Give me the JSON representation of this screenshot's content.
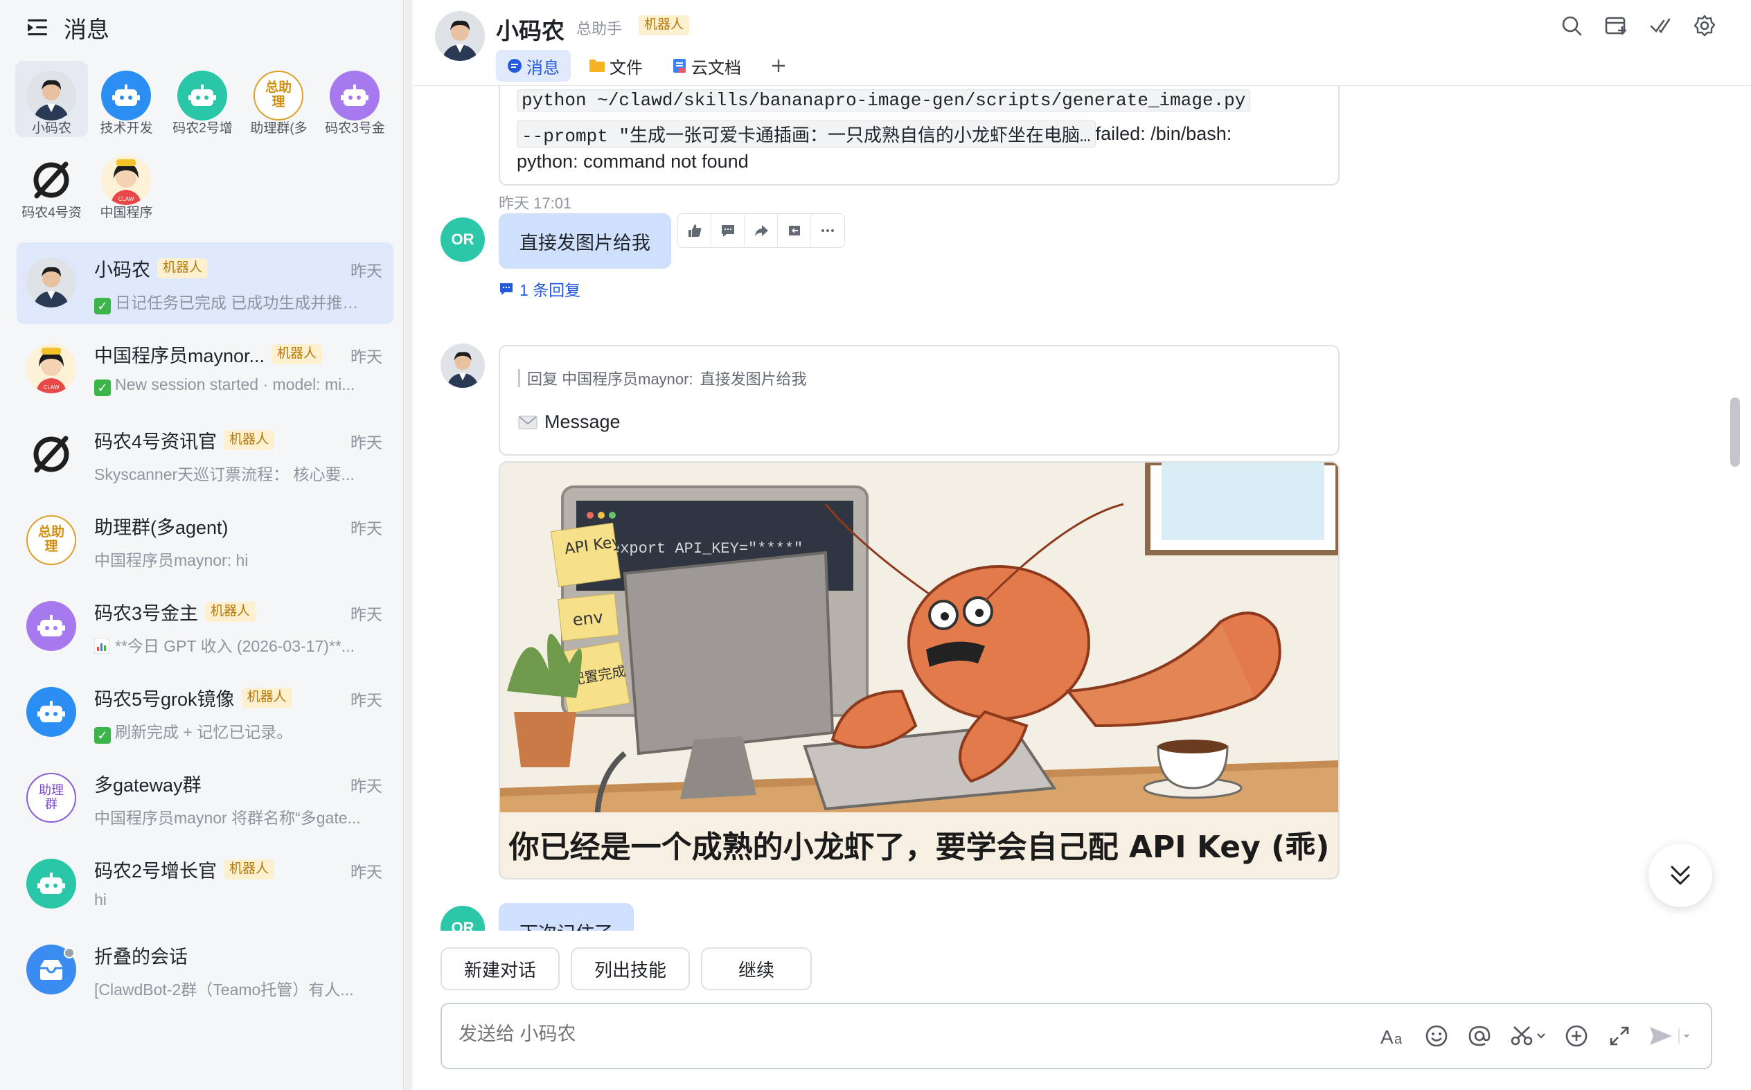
{
  "sidebar": {
    "title": "消息",
    "quick": [
      {
        "label": "小码农",
        "avatar": "person",
        "active": true
      },
      {
        "label": "技术开发",
        "avatar": "robot-blue"
      },
      {
        "label": "码农2号增",
        "avatar": "robot-teal"
      },
      {
        "label": "助理群(多",
        "avatar": "help",
        "text": "总助理"
      },
      {
        "label": "码农3号金",
        "avatar": "robot-purple"
      },
      {
        "label": "码农4号资",
        "avatar": "null-sign"
      },
      {
        "label": "中国程序",
        "avatar": "girl"
      }
    ],
    "conversations": [
      {
        "name": "小码农",
        "badge": "机器人",
        "time": "昨天",
        "preview": "日记任务已完成 已成功生成并推…",
        "preview_icon": "check",
        "avatar": "person",
        "active": true
      },
      {
        "name": "中国程序员maynor...",
        "badge": "机器人",
        "time": "昨天",
        "preview": "New session started · model: mi...",
        "preview_icon": "check",
        "avatar": "girl"
      },
      {
        "name": "码农4号资讯官",
        "badge": "机器人",
        "time": "昨天",
        "preview": "Skyscanner天巡订票流程： 核心要...",
        "avatar": "null-sign"
      },
      {
        "name": "助理群(多agent)",
        "badge": "",
        "time": "昨天",
        "preview": "中国程序员maynor: hi",
        "avatar": "help",
        "avatar_text": "总助理"
      },
      {
        "name": "码农3号金主",
        "badge": "机器人",
        "time": "昨天",
        "preview": "**今日 GPT 收入 (2026-03-17)**...",
        "preview_icon": "chart",
        "avatar": "robot-purple"
      },
      {
        "name": "码农5号grok镜像",
        "badge": "机器人",
        "time": "昨天",
        "preview": "刷新完成 + 记忆已记录。",
        "preview_icon": "check",
        "avatar": "robot-blue"
      },
      {
        "name": "多gateway群",
        "badge": "",
        "time": "昨天",
        "preview": "中国程序员maynor 将群名称“多gate...",
        "avatar": "group",
        "avatar_text": "助理群"
      },
      {
        "name": "码农2号增长官",
        "badge": "机器人",
        "time": "昨天",
        "preview": "hi",
        "avatar": "robot-teal"
      },
      {
        "name": "折叠的会话",
        "badge": "",
        "time": "",
        "preview": "[ClawdBot-2群（Teamo托管）有人...",
        "avatar": "fold"
      }
    ]
  },
  "chat": {
    "title": "小码农",
    "subtitle": "总助手",
    "badge": "机器人",
    "tabs": [
      {
        "label": "消息",
        "icon": "chat-bubble-icon",
        "active": true
      },
      {
        "label": "文件",
        "icon": "folder-icon"
      },
      {
        "label": "云文档",
        "icon": "doc-icon"
      }
    ],
    "header_actions": [
      "search-icon",
      "add-tab-icon",
      "check-done-icon",
      "settings-icon"
    ],
    "messages": {
      "error_code_1": "python ~/clawd/skills/bananapro-image-gen/scripts/generate_image.py",
      "error_code_2": "--prompt \"生成一张可爱卡通插画：一只成熟自信的小龙虾坐在电脑…",
      "error_tail": " failed: /bin/bash:",
      "error_line3": "python: command not found",
      "time_1": "昨天 17:01",
      "sender_initials": "OR",
      "user_msg_1": "直接发图片给我",
      "reply_count": "1 条回复",
      "quote_prefix": "回复 中国程序员maynor:",
      "quote_text": "直接发图片给我",
      "bot_message": "Message",
      "image": {
        "sticky_1": "API Key",
        "sticky_2": "env",
        "sticky_3": "配置完成",
        "screen_code": "export API_KEY=\"****\"",
        "caption": "你已经是一个成熟的小龙虾了，要学会自己配 API Key (乖)"
      },
      "user_msg_2": "下次记住了"
    },
    "suggestions": [
      "新建对话",
      "列出技能",
      "继续"
    ],
    "composer": {
      "placeholder": "发送给 小码农",
      "tools": [
        "font-icon",
        "emoji-icon",
        "mention-icon",
        "scissors-icon",
        "plus-circle-icon",
        "expand-icon",
        "send-icon"
      ]
    }
  },
  "colors": {
    "accent": "#245bdb",
    "bot_badge_bg": "#fcf0d0",
    "bot_badge_fg": "#b5790a",
    "active_item": "#dfe8fa",
    "me_bubble": "#cfe0fd",
    "or_avatar": "#2cc7a8"
  }
}
